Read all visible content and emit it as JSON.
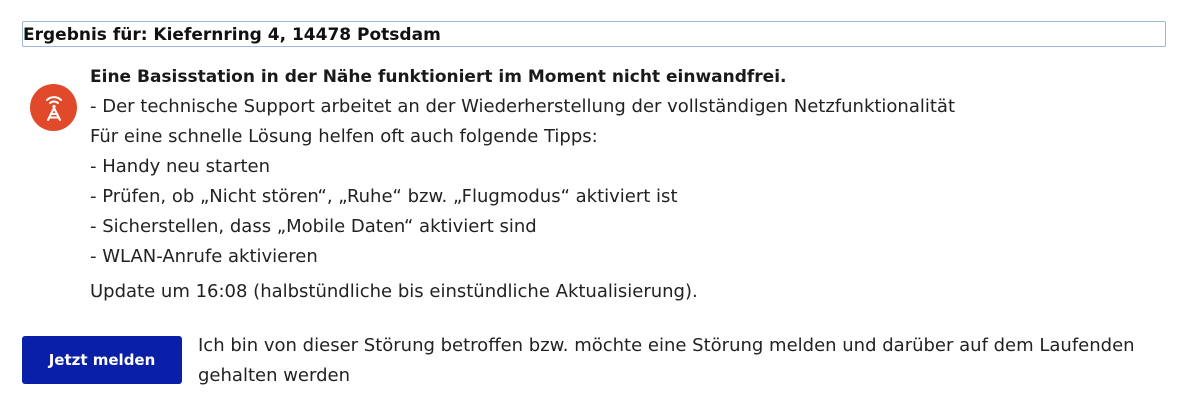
{
  "result": {
    "heading": "Ergebnis für: Kiefernring 4, 14478 Potsdam"
  },
  "status": {
    "icon": "cell-tower-icon",
    "icon_color": "#e04a2b",
    "title": "Eine Basisstation in der Nähe funktioniert im Moment nicht einwandfrei.",
    "lines": [
      "- Der technische Support arbeitet an der Wiederherstellung der vollständigen Netzfunktionalität",
      "Für eine schnelle Lösung helfen oft auch folgende Tipps:",
      "- Handy neu starten",
      "- Prüfen, ob „Nicht stören“, „Ruhe“ bzw. „Flugmodus“ aktiviert ist",
      "- Sicherstellen, dass „Mobile Daten“ aktiviert sind",
      "- WLAN-Anrufe aktivieren"
    ],
    "update": "Update um 16:08 (halbstündliche bis einstündliche Aktualisierung)."
  },
  "report": {
    "button_label": "Jetzt melden",
    "button_color": "#0a1fa8",
    "description": "Ich bin von dieser Störung betroffen bzw. möchte eine Störung melden und darüber auf dem Laufenden gehalten werden"
  }
}
